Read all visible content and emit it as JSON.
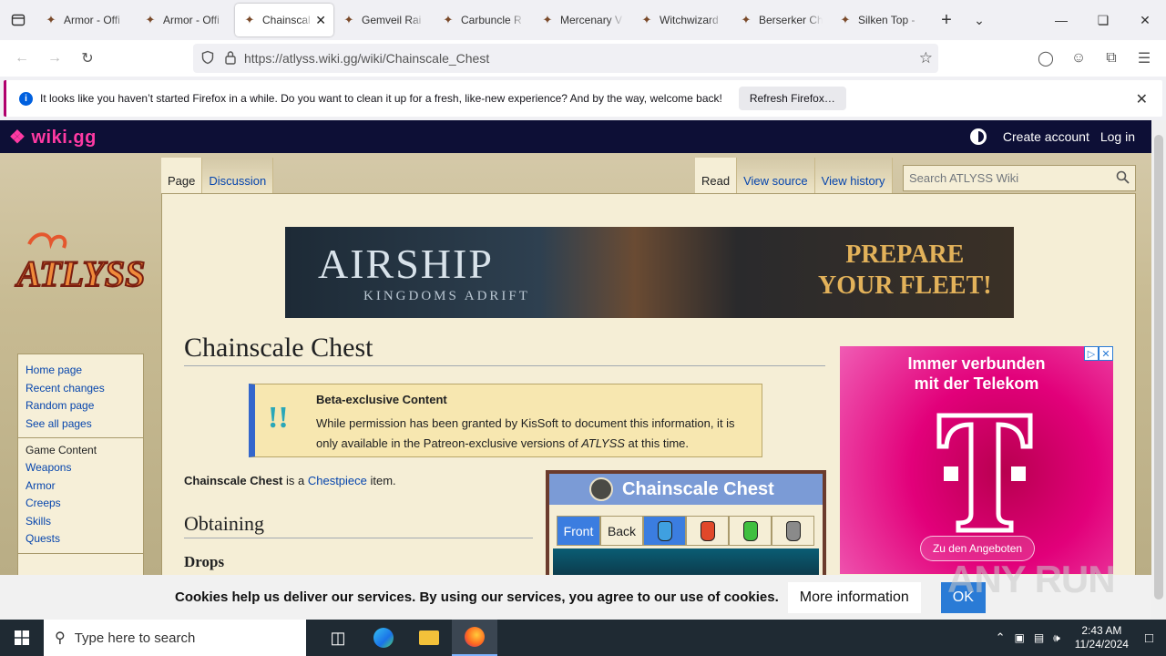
{
  "browser": {
    "tabs": [
      {
        "title": "Armor - Offi",
        "active": false
      },
      {
        "title": "Armor - Offi",
        "active": false
      },
      {
        "title": "Chainscal",
        "active": true
      },
      {
        "title": "Gemveil Rai",
        "active": false
      },
      {
        "title": "Carbuncle R",
        "active": false
      },
      {
        "title": "Mercenary V",
        "active": false
      },
      {
        "title": "Witchwizard",
        "active": false
      },
      {
        "title": "Berserker Ch",
        "active": false
      },
      {
        "title": "Silken Top -",
        "active": false
      }
    ],
    "url": "https://atlyss.wiki.gg/wiki/Chainscale_Chest",
    "notification": {
      "text": "It looks like you haven’t started Firefox in a while. Do you want to clean it up for a fresh, like-new experience? And by the way, welcome back!",
      "button": "Refresh Firefox…"
    }
  },
  "wiki": {
    "brand": "wiki.gg",
    "create_account": "Create account",
    "log_in": "Log in",
    "site_logo": "ATLYSS",
    "tabs_left": [
      "Page",
      "Discussion"
    ],
    "tabs_right": [
      "Read",
      "View source",
      "View history"
    ],
    "search_placeholder": "Search ATLYSS Wiki",
    "sidebar": {
      "nav": [
        "Home page",
        "Recent changes",
        "Random page",
        "See all pages"
      ],
      "section_title": "Game Content",
      "content": [
        "Weapons",
        "Armor",
        "Creeps",
        "Skills",
        "Quests"
      ]
    },
    "banner": {
      "line1": "AIRSHIP",
      "line2": "KINGDOMS ADRIFT",
      "line3": "PREPARE",
      "line4": "YOUR FLEET!"
    },
    "page_title": "Chainscale Chest",
    "beta": {
      "heading": "Beta-exclusive Content",
      "text_before": "While permission has been granted by KisSoft to document this information, it is only available in the Patreon-exclusive versions of ",
      "text_game": "ATLYSS",
      "text_after": " at this time."
    },
    "intro": {
      "bold": "Chainscale Chest",
      "middle": " is a ",
      "link": "Chestpiece",
      "end": " item."
    },
    "h2_obtaining": "Obtaining",
    "h3_drops": "Drops",
    "infobox": {
      "title": "Chainscale Chest",
      "front": "Front",
      "back": "Back",
      "swatches": [
        "#3fa0e0",
        "#e0482a",
        "#3fbf3f",
        "#8a8a8a"
      ]
    },
    "ad": {
      "line1": "Immer verbunden",
      "line2": "mit der Telekom",
      "cta": "Zu den Angeboten"
    },
    "cookie": {
      "message": "Cookies help us deliver our services. By using our services, you agree to our use of cookies.",
      "more": "More information",
      "ok": "OK"
    }
  },
  "watermark": "ANY RUN",
  "taskbar": {
    "search_placeholder": "Type here to search",
    "time": "2:43 AM",
    "date": "11/24/2024"
  }
}
